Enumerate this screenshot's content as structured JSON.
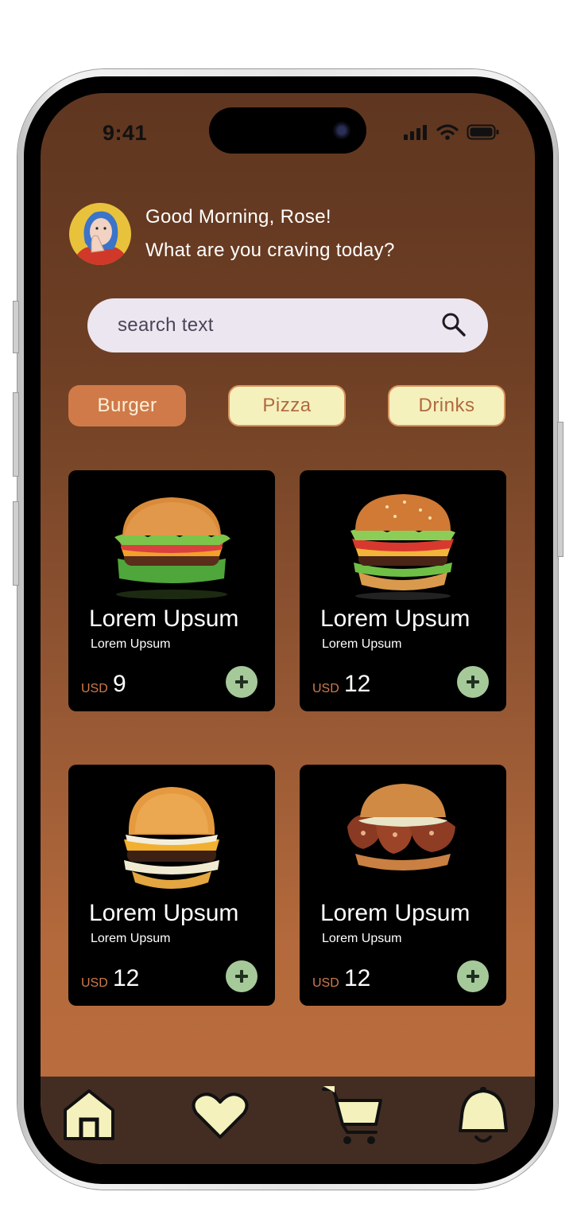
{
  "status_bar": {
    "time": "9:41"
  },
  "header": {
    "greeting": "Good Morning, Rose!",
    "question": "What are you craving today?"
  },
  "search": {
    "placeholder": "search text",
    "icon": "search-icon"
  },
  "categories": [
    {
      "label": "Burger",
      "active": true
    },
    {
      "label": "Pizza",
      "active": false
    },
    {
      "label": "Drinks",
      "active": false
    }
  ],
  "products": [
    {
      "title": "Lorem Upsum",
      "subtitle": "Lorem Upsum",
      "currency": "USD",
      "price": "9"
    },
    {
      "title": "Lorem Upsum",
      "subtitle": "Lorem Upsum",
      "currency": "USD",
      "price": "12"
    },
    {
      "title": "Lorem Upsum",
      "subtitle": "Lorem Upsum",
      "currency": "USD",
      "price": "12"
    },
    {
      "title": "Lorem Upsum",
      "subtitle": "Lorem Upsum",
      "currency": "USD",
      "price": "12"
    }
  ],
  "bottom_nav": [
    {
      "icon": "home-icon"
    },
    {
      "icon": "heart-icon"
    },
    {
      "icon": "cart-icon"
    },
    {
      "icon": "bell-icon"
    }
  ],
  "colors": {
    "accent": "#d07a4a",
    "chip_idle_bg": "#f5f1bd",
    "add_button": "#a6c99a",
    "nav_bg": "#432d23",
    "nav_icon": "#f5f1bd"
  }
}
